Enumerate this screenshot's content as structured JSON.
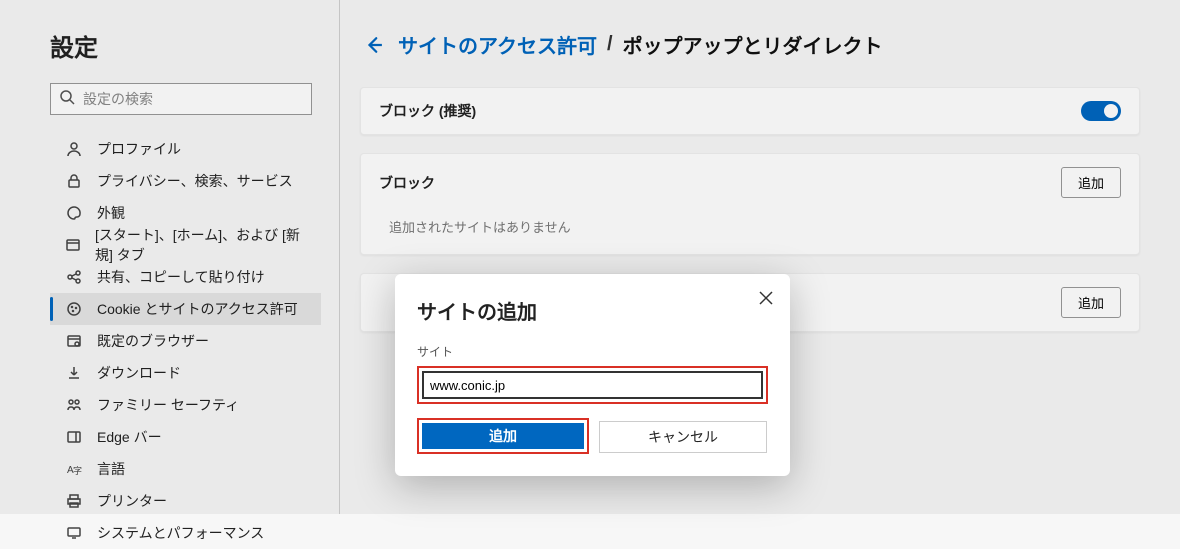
{
  "sidebar": {
    "title": "設定",
    "search_placeholder": "設定の検索",
    "items": [
      {
        "label": "プロファイル",
        "icon": "profile"
      },
      {
        "label": "プライバシー、検索、サービス",
        "icon": "privacy"
      },
      {
        "label": "外観",
        "icon": "appearance"
      },
      {
        "label": "[スタート]、[ホーム]、および [新規] タブ",
        "icon": "start"
      },
      {
        "label": "共有、コピーして貼り付け",
        "icon": "share"
      },
      {
        "label": "Cookie とサイトのアクセス許可",
        "icon": "cookies"
      },
      {
        "label": "既定のブラウザー",
        "icon": "default-browser"
      },
      {
        "label": "ダウンロード",
        "icon": "downloads"
      },
      {
        "label": "ファミリー セーフティ",
        "icon": "family"
      },
      {
        "label": "Edge バー",
        "icon": "edge-bar"
      },
      {
        "label": "言語",
        "icon": "languages"
      },
      {
        "label": "プリンター",
        "icon": "printers"
      },
      {
        "label": "システムとパフォーマンス",
        "icon": "system"
      }
    ]
  },
  "breadcrumb": {
    "link": "サイトのアクセス許可",
    "separator": "/",
    "current": "ポップアップとリダイレクト"
  },
  "cards": {
    "recommended": {
      "label": "ブロック (推奨)"
    },
    "block": {
      "label": "ブロック",
      "add_button": "追加",
      "empty": "追加されたサイトはありません"
    },
    "allow": {
      "add_button": "追加"
    }
  },
  "dialog": {
    "title": "サイトの追加",
    "field_label": "サイト",
    "input_value": "www.conic.jp",
    "add_button": "追加",
    "cancel_button": "キャンセル"
  }
}
